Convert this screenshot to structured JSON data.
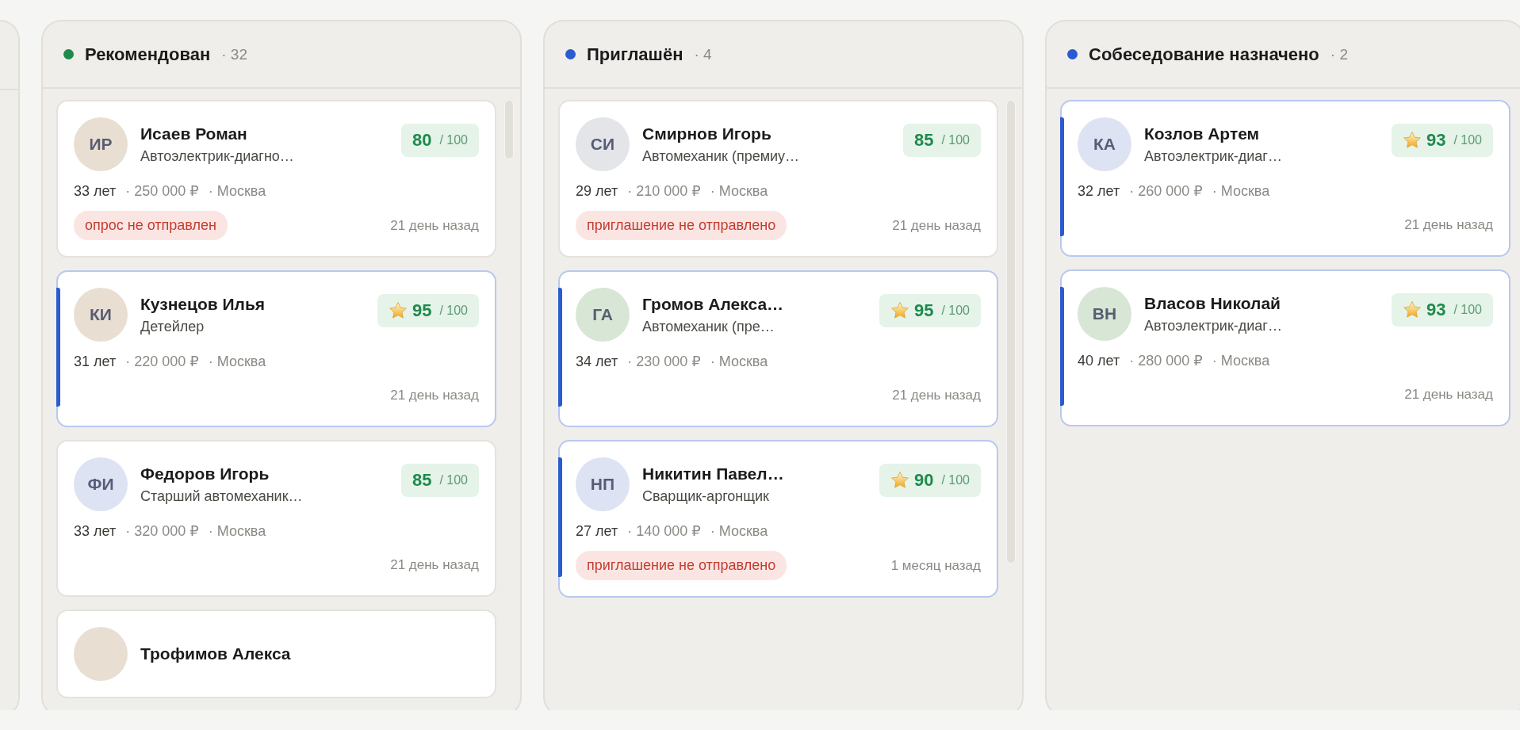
{
  "columns": [
    {
      "title": "Рекомендован",
      "count": "· 32",
      "color": "#1e8a4c",
      "cards": [
        {
          "initials": "ИР",
          "color": "#e8dfd2",
          "name": "Исаев Роман",
          "role": "Автоэлектрик-диагно…",
          "starred": false,
          "score": "80",
          "score_max": "/ 100",
          "age": "33 лет",
          "salary": "· 250 000 ₽",
          "city": "· Москва",
          "tag": "опрос не отправлен",
          "time": "21 день назад",
          "highlighted": false
        },
        {
          "initials": "КИ",
          "color": "#e8dfd2",
          "name": "Кузнецов Илья",
          "role": "Детейлер",
          "starred": true,
          "score": "95",
          "score_max": "/ 100",
          "age": "31 лет",
          "salary": "· 220 000 ₽",
          "city": "· Москва",
          "time": "21 день назад",
          "highlighted": true
        },
        {
          "initials": "ФИ",
          "color": "#dde3f3",
          "name": "Федоров Игорь",
          "role": "Старший автомеханик…",
          "starred": false,
          "score": "85",
          "score_max": "/ 100",
          "age": "33 лет",
          "salary": "· 320 000 ₽",
          "city": "· Москва",
          "time": "21 день назад",
          "highlighted": false
        },
        {
          "color": "#e8dfd2",
          "name": "Трофимов Алекса",
          "highlighted": false
        }
      ]
    },
    {
      "title": "Приглашён",
      "count": "· 4",
      "color": "#2b5bd0",
      "cards": [
        {
          "initials": "СИ",
          "color": "#e3e5e8",
          "name": "Смирнов Игорь",
          "role": "Автомеханик (премиу…",
          "starred": false,
          "score": "85",
          "score_max": "/ 100",
          "age": "29 лет",
          "salary": "· 210 000 ₽",
          "city": "· Москва",
          "tag": "приглашение не отправлено",
          "time": "21 день назад",
          "highlighted": false
        },
        {
          "initials": "ГА",
          "color": "#d8e6d6",
          "name": "Громов Алекса…",
          "role": "Автомеханик (пре…",
          "starred": true,
          "score": "95",
          "score_max": "/ 100",
          "age": "34 лет",
          "salary": "· 230 000 ₽",
          "city": "· Москва",
          "time": "21 день назад",
          "highlighted": true
        },
        {
          "initials": "НП",
          "color": "#dde3f3",
          "name": "Никитин Павел…",
          "role": "Сварщик-аргонщик",
          "starred": true,
          "score": "90",
          "score_max": "/ 100",
          "age": "27 лет",
          "salary": "· 140 000 ₽",
          "city": "· Москва",
          "tag": "приглашение не отправлено",
          "time": "1 месяц назад",
          "highlighted": true
        }
      ]
    },
    {
      "title": "Собеседование назначено",
      "count": "· 2",
      "color": "#2b5bd0",
      "cards": [
        {
          "initials": "КА",
          "color": "#dde3f3",
          "name": "Козлов Артем",
          "role": "Автоэлектрик-диаг…",
          "starred": true,
          "score": "93",
          "score_max": "/ 100",
          "age": "32 лет",
          "salary": "· 260 000 ₽",
          "city": "· Москва",
          "time": "21 день назад",
          "highlighted": true
        },
        {
          "initials": "ВН",
          "color": "#d8e6d6",
          "name": "Власов Николай",
          "role": "Автоэлектрик-диаг…",
          "starred": true,
          "score": "93",
          "score_max": "/ 100",
          "age": "40 лет",
          "salary": "· 280 000 ₽",
          "city": "· Москва",
          "time": "21 день назад",
          "highlighted": true
        }
      ]
    }
  ]
}
